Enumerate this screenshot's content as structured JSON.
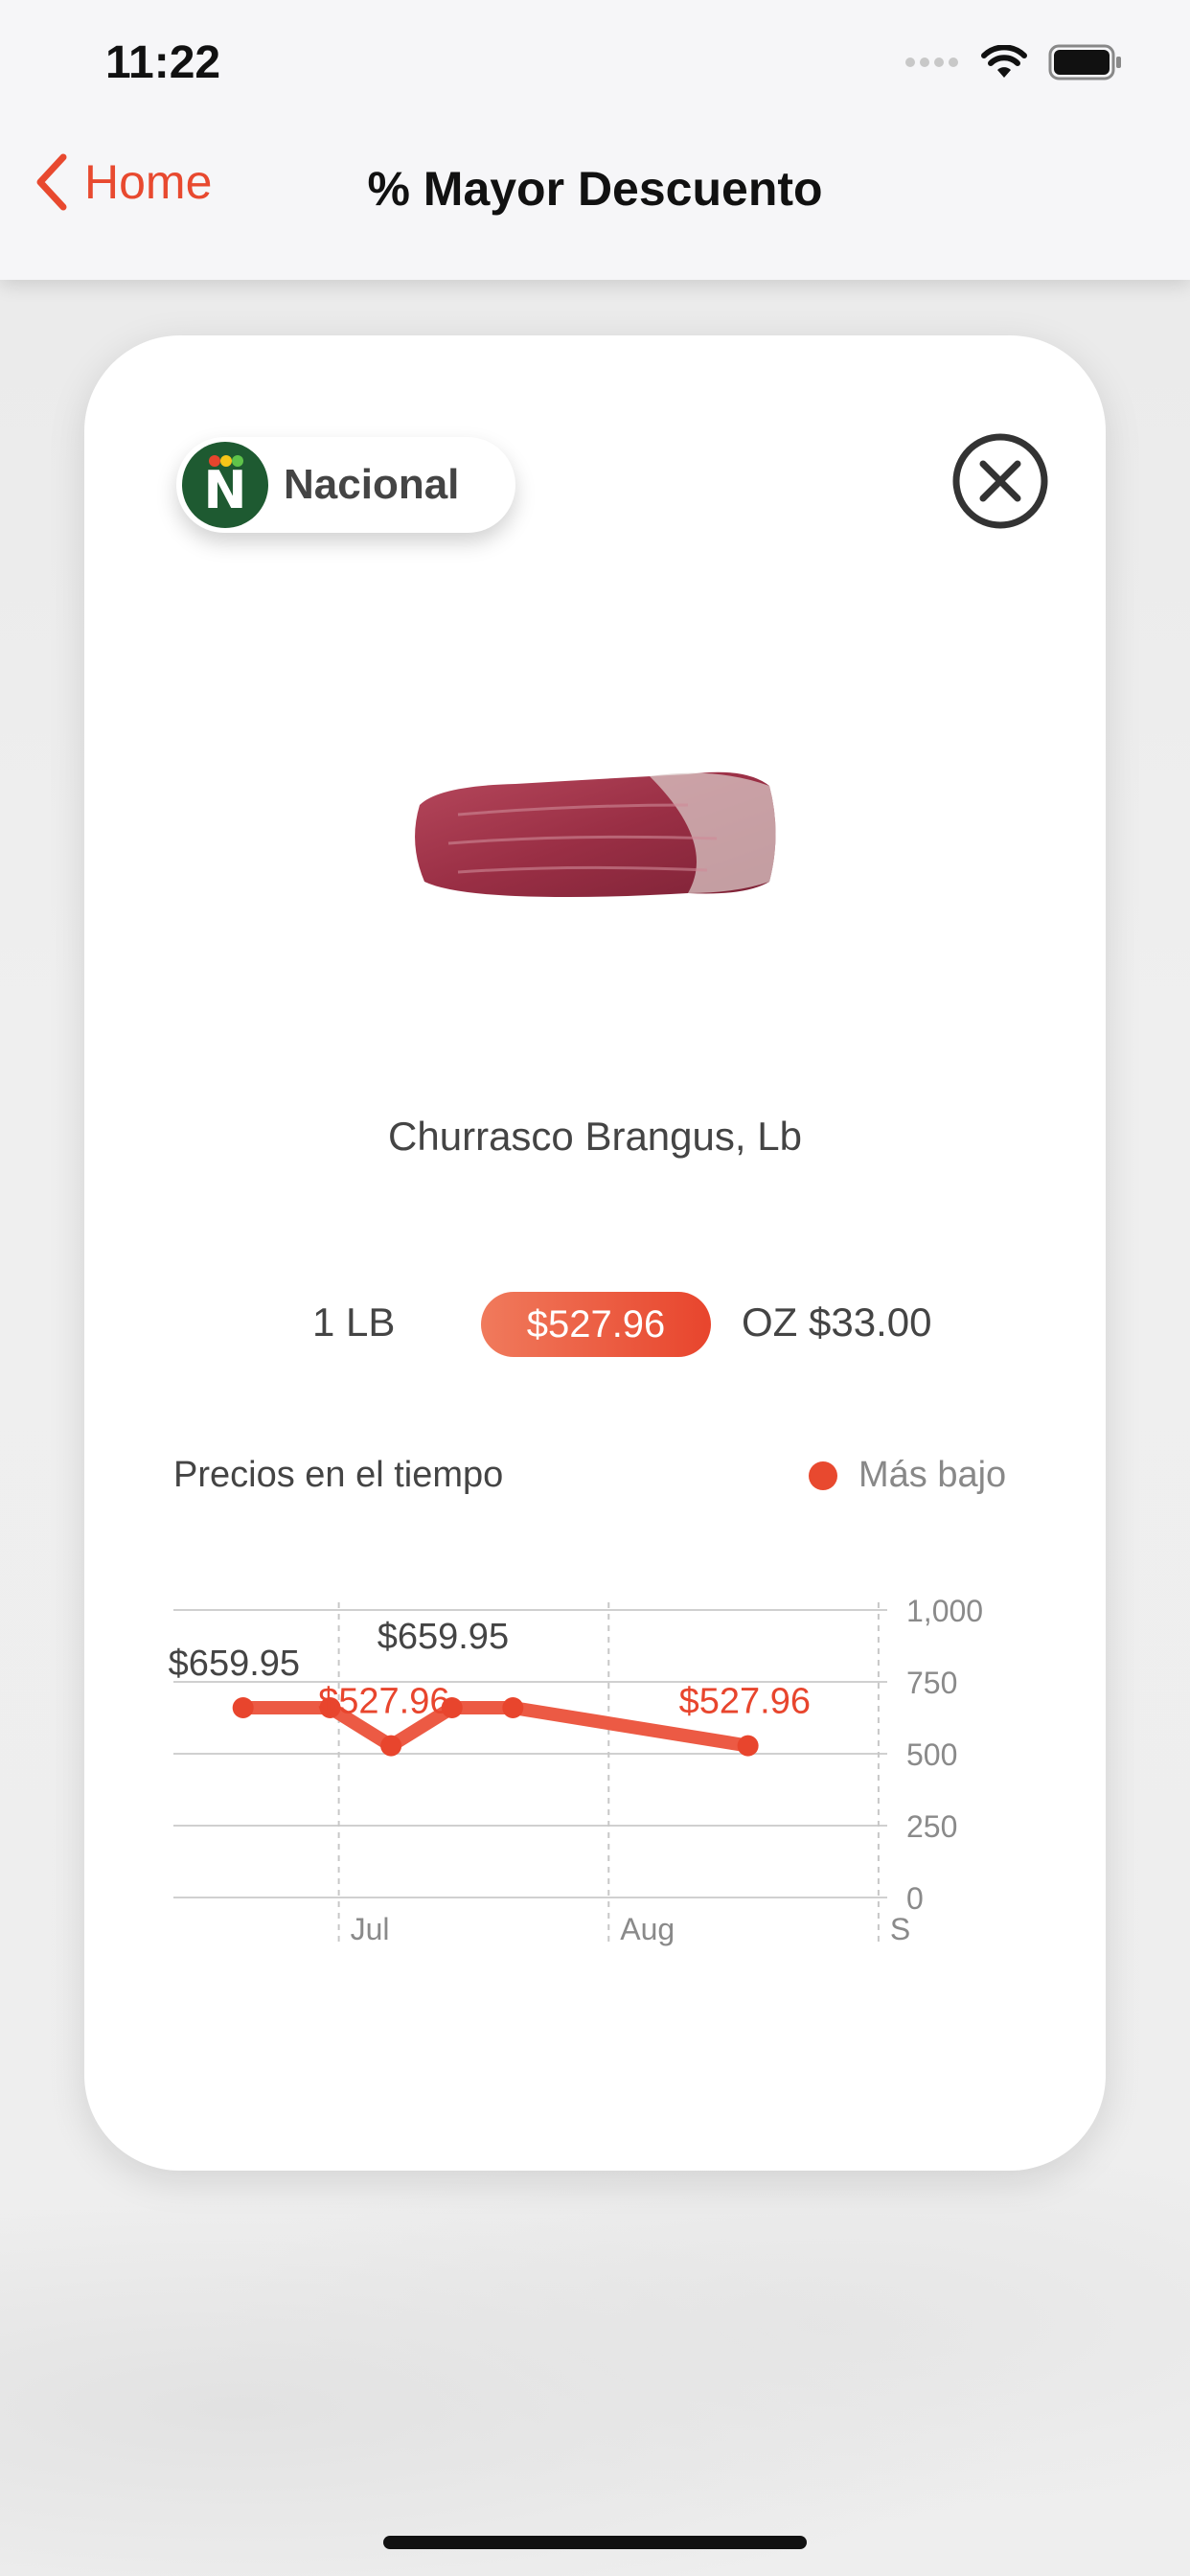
{
  "status_bar": {
    "time": "11:22"
  },
  "nav": {
    "back_label": "Home",
    "title": "% Mayor Descuento"
  },
  "store": {
    "name": "Nacional",
    "logo_letter": "N",
    "logo_color": "#1e5a31"
  },
  "product": {
    "name": "Churrasco Brangus, Lb",
    "unit": "1 LB",
    "price": "$527.96",
    "oz_price": "OZ $33.00"
  },
  "colors": {
    "accent": "#e8492f"
  },
  "chart_section": {
    "title": "Precios en el tiempo",
    "legend_label": "Más bajo"
  },
  "chart_data": {
    "type": "line",
    "series": [
      {
        "name": "Más bajo",
        "color": "#ec5a44",
        "points": [
          {
            "x": "Jun 20",
            "y": 659.95
          },
          {
            "x": "Jun 30",
            "y": 659.95
          },
          {
            "x": "Jul 7",
            "y": 527.96
          },
          {
            "x": "Jul 14",
            "y": 659.95
          },
          {
            "x": "Jul 21",
            "y": 659.95
          },
          {
            "x": "Aug 17",
            "y": 527.96
          }
        ]
      }
    ],
    "data_labels": [
      "$659.95",
      "$527.96",
      "$659.95",
      "$527.96"
    ],
    "x_ticks": [
      "Jul",
      "Aug",
      "S"
    ],
    "y_ticks": [
      "0",
      "250",
      "500",
      "750",
      "1,000"
    ],
    "ylim": [
      0,
      1000
    ],
    "grid": true,
    "legend_position": "top-right"
  }
}
